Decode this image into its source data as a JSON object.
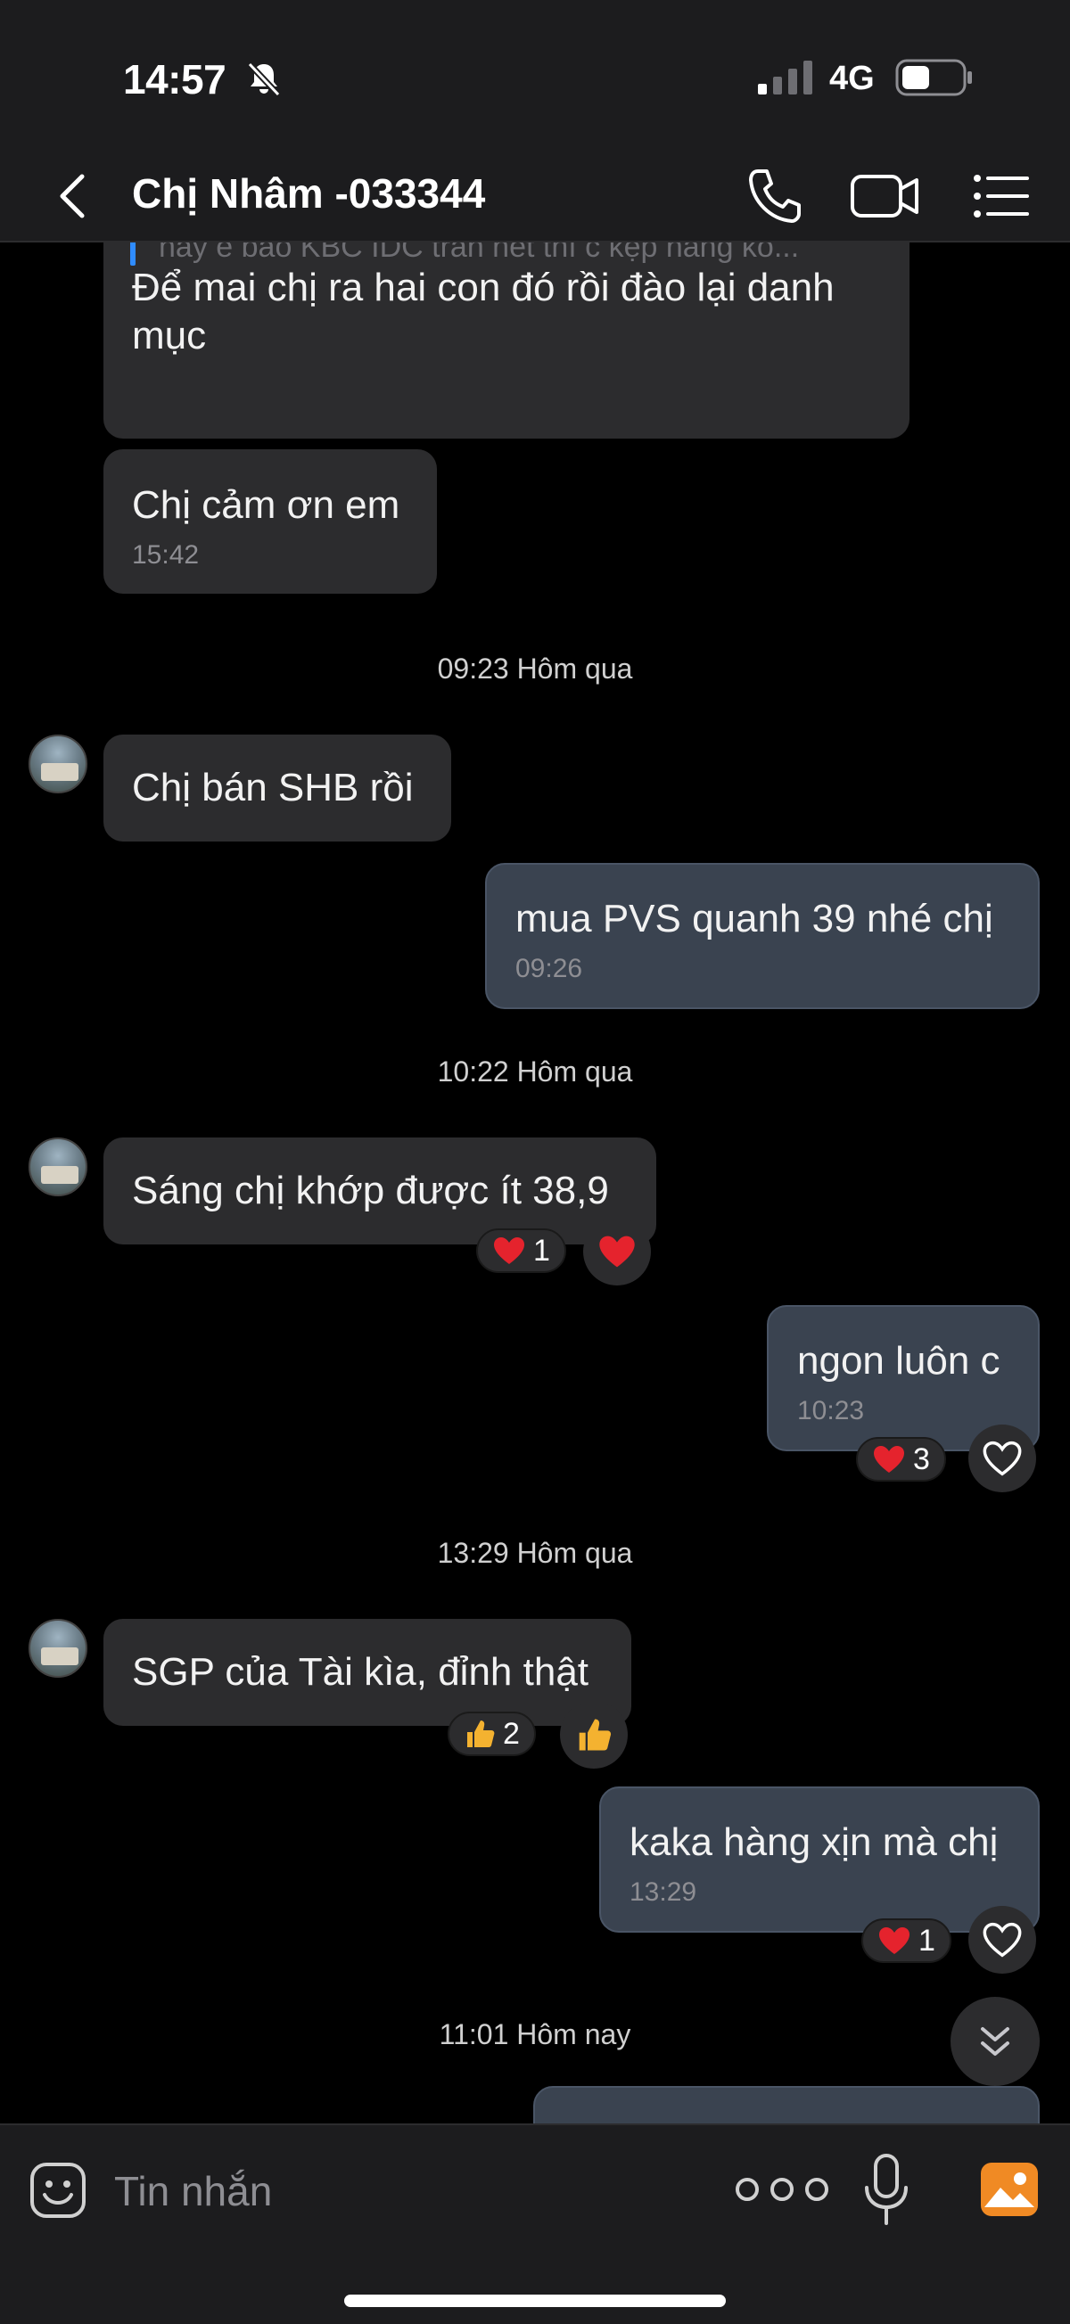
{
  "status_bar": {
    "time": "14:57",
    "network": "4G",
    "bell_icon": "bell-slash-icon",
    "signal_icon": "cellular-signal-icon",
    "battery_icon": "battery-icon"
  },
  "header": {
    "contact_name": "Chị Nhâm -033344",
    "back_icon": "chevron-left-icon",
    "call_icon": "phone-icon",
    "video_icon": "video-camera-icon",
    "menu_icon": "list-icon"
  },
  "messages": [
    {
      "kind": "received",
      "quote": "nay e bảo KBC IDC trăn hết thì c kẹp hàng ko...",
      "text": "Để mai chị ra hai con đó rồi đào lại danh",
      "text2": "mục"
    },
    {
      "kind": "received",
      "text": "Chị cảm ơn em",
      "time": "15:42"
    },
    {
      "kind": "divider",
      "text": "09:23 Hôm qua"
    },
    {
      "kind": "received",
      "text": "Chị bán SHB rồi"
    },
    {
      "kind": "sent",
      "text": "mua PVS quanh 39 nhé chị",
      "time": "09:26"
    },
    {
      "kind": "divider",
      "text": "10:22 Hôm qua"
    },
    {
      "kind": "received",
      "text": "Sáng chị khớp được ít 38,9",
      "reaction": {
        "emoji": "heart",
        "count": "1"
      }
    },
    {
      "kind": "sent",
      "text": "ngon luôn c",
      "time": "10:23",
      "reaction": {
        "emoji": "heart",
        "count": "3"
      }
    },
    {
      "kind": "divider",
      "text": "13:29 Hôm qua"
    },
    {
      "kind": "received",
      "text": "SGP của Tài kìa, đỉnh thật",
      "reaction": {
        "emoji": "thumbs-up",
        "count": "2"
      }
    },
    {
      "kind": "sent",
      "text": "kaka hàng xịn mà chị",
      "time": "13:29",
      "reaction": {
        "emoji": "heart",
        "count": "1"
      }
    },
    {
      "kind": "divider",
      "text": "11:01 Hôm nay"
    }
  ],
  "composer": {
    "placeholder": "Tin nhắn",
    "emoji_icon": "emoji-icon",
    "more_icon": "more-dots-icon",
    "mic_icon": "microphone-icon",
    "image_icon": "image-icon"
  },
  "colors": {
    "background": "#000000",
    "received_bubble": "#2c2c2e",
    "sent_bubble": "#3a4350",
    "heart": "#e5232d",
    "thumbs": "#f4b230",
    "image_button": "#f08a24"
  }
}
